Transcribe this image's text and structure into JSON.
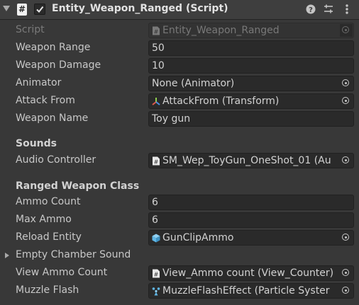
{
  "header": {
    "title": "Entity_Weapon_Ranged (Script)",
    "enabled": true,
    "icons": [
      "help-icon",
      "presets-icon",
      "context-menu-icon"
    ]
  },
  "fields": {
    "script": {
      "label": "Script",
      "value": "Entity_Weapon_Ranged"
    },
    "weapon_range": {
      "label": "Weapon Range",
      "value": "50"
    },
    "weapon_damage": {
      "label": "Weapon Damage",
      "value": "10"
    },
    "animator": {
      "label": "Animator",
      "value": "None (Animator)"
    },
    "attack_from": {
      "label": "Attack From",
      "value": "AttackFrom (Transform)"
    },
    "weapon_name": {
      "label": "Weapon Name",
      "value": "Toy gun"
    }
  },
  "sounds": {
    "heading": "Sounds",
    "audio_controller": {
      "label": "Audio Controller",
      "value": "SM_Wep_ToyGun_OneShot_01 (Au"
    }
  },
  "ranged": {
    "heading": "Ranged Weapon Class",
    "ammo_count": {
      "label": "Ammo Count",
      "value": "6"
    },
    "max_ammo": {
      "label": "Max Ammo",
      "value": "6"
    },
    "reload_entity": {
      "label": "Reload Entity",
      "value": "GunClipAmmo"
    },
    "empty_chamber_sound": {
      "label": "Empty Chamber Sound"
    },
    "view_ammo_count": {
      "label": "View Ammo Count",
      "value": "View_Ammo count (View_Counter)"
    },
    "muzzle_flash": {
      "label": "Muzzle Flash",
      "value": "MuzzleFlashEffect (Particle Syster"
    }
  },
  "colors": {
    "background": "#383838",
    "header": "#3e3e3e",
    "field": "#2a2a2a",
    "text": "#c8c8c8",
    "dim_text": "#7a7a7a",
    "prefab_blue": "#5fb6e6"
  }
}
